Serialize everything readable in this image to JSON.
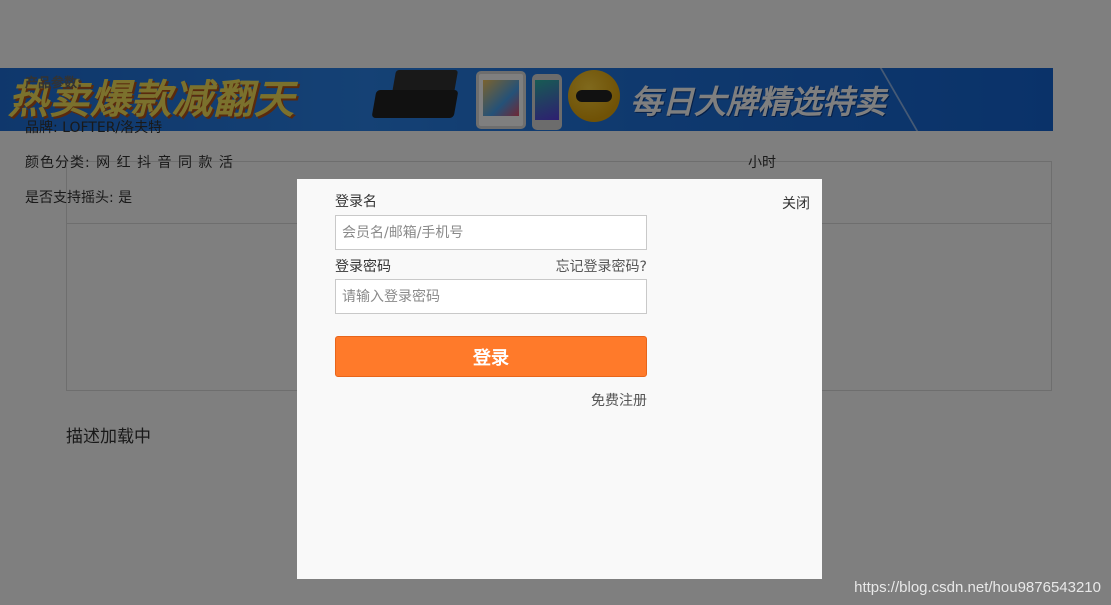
{
  "banner": {
    "left_text": "热卖爆款减翻天",
    "right_text": "每日大牌精选特卖"
  },
  "params": {
    "title": "产品参数:",
    "brand": "品牌: LOFTER/洛夫特",
    "color_category": "颜色分类: 网 红 抖 音 同 款 活",
    "color_tail": "小时",
    "swing": "是否支持摇头: 是"
  },
  "description_loading": "描述加载中",
  "login_dialog": {
    "close_label": "关闭",
    "username_label": "登录名",
    "username_placeholder": "会员名/邮箱/手机号",
    "password_label": "登录密码",
    "forgot_password": "忘记登录密码?",
    "password_placeholder": "请输入登录密码",
    "login_button": "登录",
    "register_link": "免费注册"
  },
  "watermark": "https://blog.csdn.net/hou9876543210",
  "colors": {
    "overlay": "rgba(0,0,0,0.5)",
    "login_button": "#ff7a2a",
    "dialog_bg": "#f9f9f9",
    "banner_blue": "#1e6fd9",
    "banner_yellow_text": "#f7e25a"
  }
}
